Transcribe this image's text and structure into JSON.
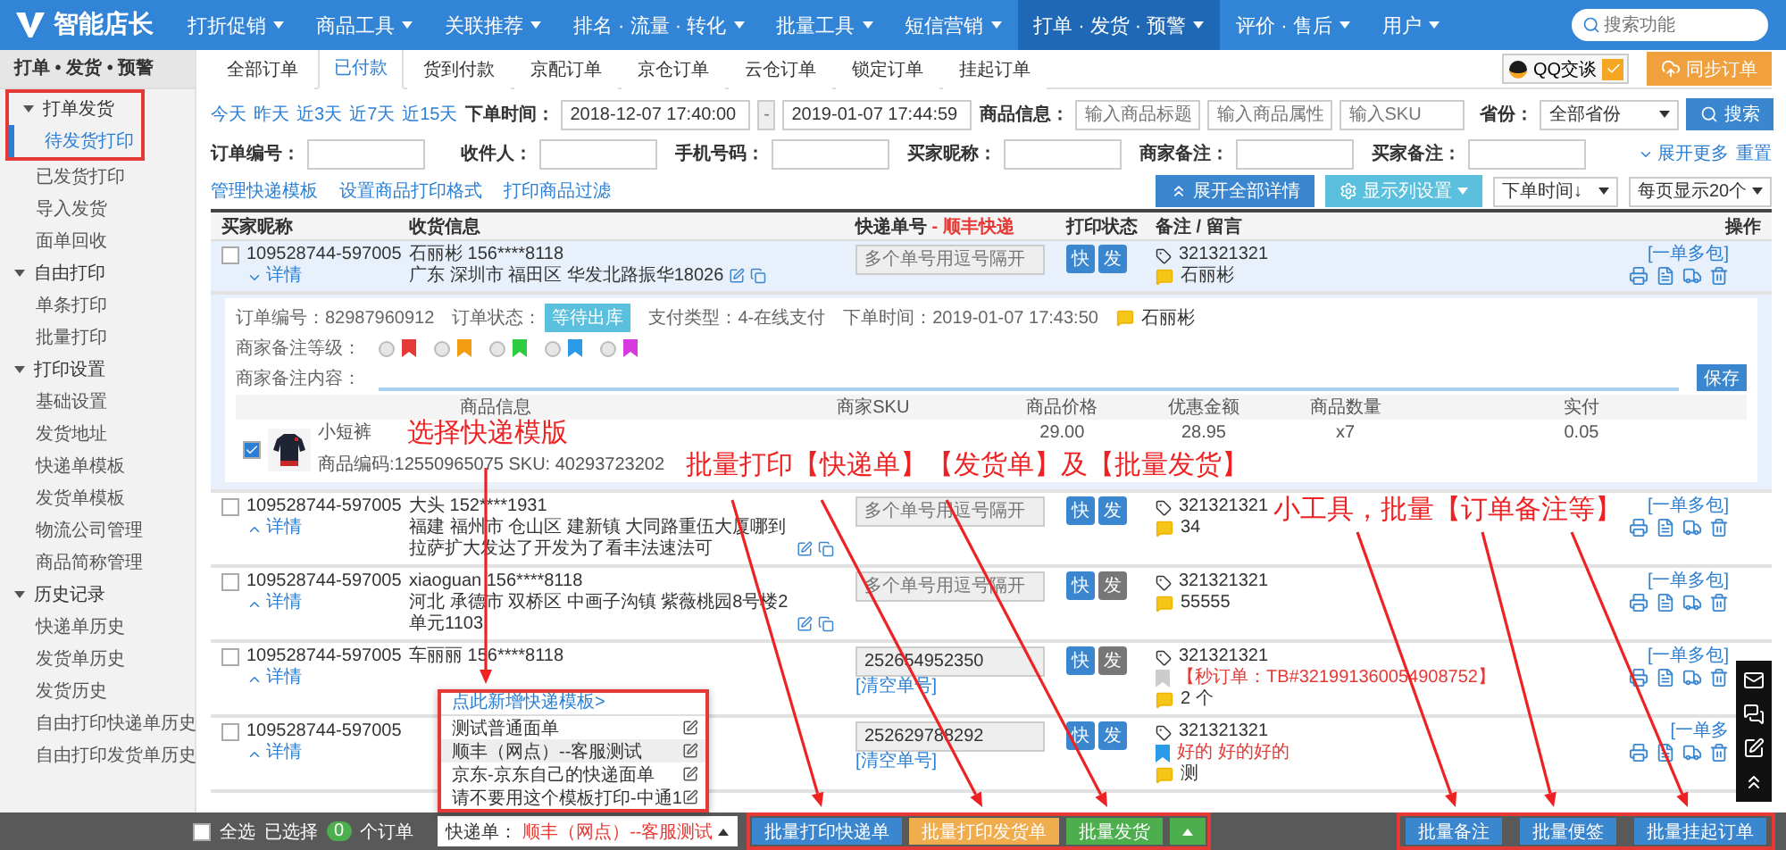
{
  "nav": {
    "logo": "智能店长",
    "search_placeholder": "搜索功能",
    "items": [
      {
        "label": "打折促销",
        "selected": false
      },
      {
        "label": "商品工具",
        "selected": false
      },
      {
        "label": "关联推荐",
        "selected": false
      },
      {
        "label": "排名 · 流量 · 转化",
        "selected": false
      },
      {
        "label": "批量工具",
        "selected": false
      },
      {
        "label": "短信营销",
        "selected": false
      },
      {
        "label": "打单 · 发货 · 预警",
        "selected": true
      },
      {
        "label": "评价 · 售后",
        "selected": false
      },
      {
        "label": "用户",
        "selected": false
      }
    ]
  },
  "sidebar": {
    "title": "打单 • 发货 • 预警",
    "groups": [
      {
        "label": "打单发货",
        "expanded": true,
        "marked": true,
        "items": [
          {
            "label": "待发货打印",
            "selected": true
          },
          {
            "label": "已发货打印",
            "selected": false
          },
          {
            "label": "导入发货",
            "selected": false
          },
          {
            "label": "面单回收",
            "selected": false
          }
        ]
      },
      {
        "label": "自由打印",
        "expanded": true,
        "marked": false,
        "items": [
          {
            "label": "单条打印",
            "selected": false
          },
          {
            "label": "批量打印",
            "selected": false
          }
        ]
      },
      {
        "label": "打印设置",
        "expanded": true,
        "marked": false,
        "items": [
          {
            "label": "基础设置",
            "selected": false
          },
          {
            "label": "发货地址",
            "selected": false
          },
          {
            "label": "快递单模板",
            "selected": false
          },
          {
            "label": "发货单模板",
            "selected": false
          },
          {
            "label": "物流公司管理",
            "selected": false
          },
          {
            "label": "商品简称管理",
            "selected": false
          }
        ]
      },
      {
        "label": "历史记录",
        "expanded": true,
        "marked": false,
        "items": [
          {
            "label": "快递单历史",
            "selected": false
          },
          {
            "label": "发货单历史",
            "selected": false
          },
          {
            "label": "发货历史",
            "selected": false
          },
          {
            "label": "自由打印快递单历史",
            "selected": false
          },
          {
            "label": "自由打印发货单历史",
            "selected": false
          }
        ]
      }
    ]
  },
  "tabs": [
    {
      "label": "全部订单",
      "selected": false
    },
    {
      "label": "已付款",
      "selected": true
    },
    {
      "label": "货到付款",
      "selected": false
    },
    {
      "label": "京配订单",
      "selected": false
    },
    {
      "label": "京仓订单",
      "selected": false
    },
    {
      "label": "云仓订单",
      "selected": false
    },
    {
      "label": "锁定订单",
      "selected": false
    },
    {
      "label": "挂起订单",
      "selected": false
    }
  ],
  "qq_chat": "QQ交谈",
  "sync_button": "同步订单",
  "filters": {
    "quick_dates": [
      "今天",
      "昨天",
      "近3天",
      "近7天",
      "近15天"
    ],
    "time_label": "下单时间：",
    "time_from": "2018-12-07 17:40:00",
    "time_separator": "-",
    "time_to": "2019-01-07 17:44:59",
    "product_label": "商品信息：",
    "product_placeholders": [
      "输入商品标题",
      "输入商品属性",
      "输入SKU"
    ],
    "province_label": "省份：",
    "province_value": "全部省份",
    "search_button": "搜索",
    "fields": [
      {
        "label": "订单编号："
      },
      {
        "label": "收件人："
      },
      {
        "label": "手机号码："
      },
      {
        "label": "买家昵称："
      },
      {
        "label": "商家备注："
      },
      {
        "label": "买家备注："
      }
    ],
    "expand_more": "展开更多",
    "reset": "重置"
  },
  "toolbar": {
    "links": [
      "管理快递模板",
      "设置商品打印格式",
      "打印商品过滤"
    ],
    "expand_all": "展开全部详情",
    "column_settings": "显示列设置",
    "sort_value": "下单时间↓",
    "page_size_value": "每页显示20个"
  },
  "table": {
    "columns": [
      "买家昵称",
      "收货信息",
      "快递单号",
      "打印状态",
      "备注 / 留言",
      "操作"
    ],
    "courier": "- 顺丰快递",
    "rows": [
      {
        "order_no": "109528744-597005",
        "detail": "详情",
        "expanded": true,
        "selected": false,
        "recipient": "石丽彬 156****8118",
        "address": "广东 深圳市 福田区 华发北路振华18026",
        "tracking_placeholder": "多个单号用逗号隔开",
        "print": [
          {
            "label": "快",
            "done": true
          },
          {
            "label": "发",
            "done": true
          }
        ],
        "remarks": [
          {
            "kind": "tag",
            "text": "321321321"
          },
          {
            "kind": "message",
            "text": "石丽彬"
          }
        ],
        "multi_pack": "[一单多包]",
        "details": {
          "order_no": "订单编号：82987960912",
          "status_label": "订单状态：",
          "status": "等待出库",
          "pay_type": "支付类型：4-在线支付",
          "order_time": "下单时间：2019-01-07 17:43:50",
          "buyer": "石丽彬",
          "flag_label": "商家备注等级：",
          "flags": [
            {
              "color": "#e53935",
              "selected": false
            },
            {
              "color": "#f39c12",
              "selected": false
            },
            {
              "color": "#2ecc40",
              "selected": false
            },
            {
              "color": "#2b9be8",
              "selected": false
            },
            {
              "color": "#d63adf",
              "selected": false
            }
          ],
          "note_label": "商家备注内容：",
          "save": "保存",
          "product_columns": [
            "商品信息",
            "商家SKU",
            "商品价格",
            "优惠金额",
            "商品数量",
            "实付"
          ],
          "products": [
            {
              "selected": true,
              "name": "小短裤",
              "code": "商品编码:12550965075  SKU: 40293723202",
              "price": "29.00",
              "discount": "28.95",
              "quantity": "x7",
              "paid": "0.05"
            }
          ]
        }
      },
      {
        "order_no": "109528744-597005",
        "detail": "详情",
        "expanded": false,
        "selected": false,
        "recipient": "大头 152****1931",
        "address": "福建 福州市 仓山区 建新镇 大同路重伍大厦哪到拉萨扩大发达了开发为了看丰法速法可",
        "tracking_placeholder": "多个单号用逗号隔开",
        "print": [
          {
            "label": "快",
            "done": true
          },
          {
            "label": "发",
            "done": true
          }
        ],
        "remarks": [
          {
            "kind": "tag",
            "text": "321321321"
          },
          {
            "kind": "message",
            "text": "34"
          }
        ],
        "multi_pack": "[一单多包]"
      },
      {
        "order_no": "109528744-597005",
        "detail": "详情",
        "expanded": false,
        "selected": false,
        "recipient": "xiaoguan 156****8118",
        "address": "河北 承德市 双桥区 中画子沟镇 紫薇桃园8号楼2单元1103",
        "tracking_placeholder": "多个单号用逗号隔开",
        "print": [
          {
            "label": "快",
            "done": true
          },
          {
            "label": "发",
            "done": false
          }
        ],
        "remarks": [
          {
            "kind": "tag",
            "text": "321321321"
          },
          {
            "kind": "message",
            "text": "55555"
          }
        ],
        "multi_pack": "[一单多包]"
      },
      {
        "order_no": "109528744-597005",
        "detail": "详情",
        "expanded": false,
        "selected": false,
        "recipient": "车丽丽 156****8118",
        "tracking_no": "252654952350",
        "clear_link": "[清空单号]",
        "print": [
          {
            "label": "快",
            "done": true
          },
          {
            "label": "发",
            "done": false
          }
        ],
        "remarks": [
          {
            "kind": "tag",
            "text": "321321321"
          },
          {
            "kind": "flag",
            "color": "#cccccc",
            "text": "【秒订单：TB#321991360054908752】"
          },
          {
            "kind": "message",
            "text": "2 个"
          }
        ],
        "multi_pack": "[一单多包]"
      },
      {
        "order_no": "109528744-597005",
        "detail": "详情",
        "expanded": false,
        "selected": false,
        "tracking_no": "252629788292",
        "clear_link": "[清空单号]",
        "print": [
          {
            "label": "快",
            "done": true
          },
          {
            "label": "发",
            "done": true
          }
        ],
        "remarks": [
          {
            "kind": "tag",
            "text": "321321321"
          },
          {
            "kind": "flag",
            "color": "#2b9be8",
            "text": "好的 好的好的"
          },
          {
            "kind": "message",
            "text": "测"
          }
        ],
        "multi_pack": "[一单多"
      }
    ]
  },
  "template_menu": {
    "add_link": "点此新增快递模板>",
    "items": [
      {
        "label": "测试普通面单",
        "selected": false
      },
      {
        "label": "顺丰（网点）--客服测试",
        "selected": true
      },
      {
        "label": "京东-京东自己的快递面单",
        "selected": false
      },
      {
        "label": "请不要用这个模板打印-中通1",
        "selected": false
      }
    ]
  },
  "bottom_bar": {
    "select_all_checked": false,
    "select_all": "全选",
    "selected_label": "已选择",
    "selected_count": "0",
    "count_suffix": "个订单",
    "template_label": "快递单：",
    "template_value": "顺丰（网点）--客服测试",
    "actions": [
      {
        "label": "批量打印快递单",
        "color": "#3b87cf",
        "split": false
      },
      {
        "label": "批量打印发货单",
        "color": "#f0ad4e",
        "split": false
      },
      {
        "label": "批量发货",
        "color": "#4cae4c",
        "split": true
      }
    ],
    "tools": [
      "批量备注",
      "批量便签",
      "批量挂起订单"
    ]
  },
  "annotations": [
    "选择快递模版",
    "批量打印【快递单】【发货单】及【批量发货】",
    "小工具，批量【订单备注等】"
  ]
}
